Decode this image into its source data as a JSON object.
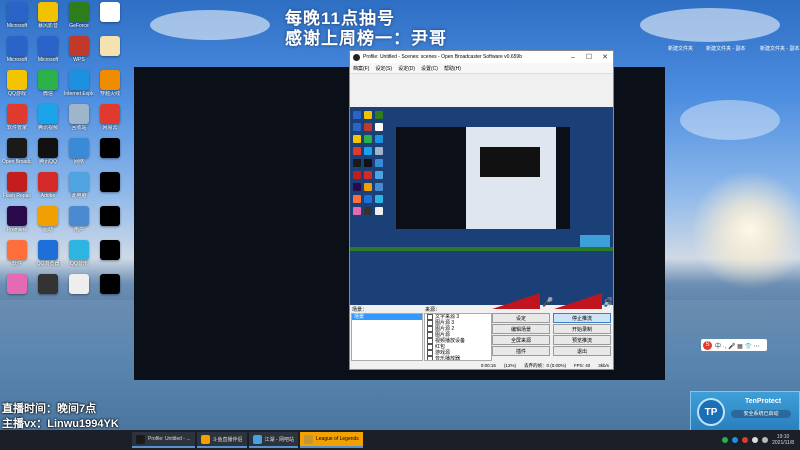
{
  "overlay": {
    "line1": "每晚11点抽号",
    "line2": "感谢上周榜一：尹哥"
  },
  "desktop_icons": [
    {
      "label": "Microsoft",
      "color": "#2a64c8"
    },
    {
      "label": "暴风影音",
      "color": "#f2c200"
    },
    {
      "label": "GeForce",
      "color": "#2e7d1b"
    },
    {
      "label": "",
      "color": "#ffffff"
    },
    {
      "label": "Microsoft",
      "color": "#2a64c8"
    },
    {
      "label": "Microsoft",
      "color": "#2a64c8"
    },
    {
      "label": "WPS",
      "color": "#c0392b"
    },
    {
      "label": "",
      "color": "#f4e2b0"
    },
    {
      "label": "QQ游戏",
      "color": "#f5c400"
    },
    {
      "label": "微信",
      "color": "#2ab14a"
    },
    {
      "label": "Internet Explorer",
      "color": "#1e90e0"
    },
    {
      "label": "穿越火线",
      "color": "#f08c00"
    },
    {
      "label": "软件管家",
      "color": "#e03a2e"
    },
    {
      "label": "腾讯视频",
      "color": "#1aa3e8"
    },
    {
      "label": "回收站",
      "color": "#9fb5c9"
    },
    {
      "label": "网易云",
      "color": "#e03a2e"
    },
    {
      "label": "Open Broadcaster",
      "color": "#1a1a1a"
    },
    {
      "label": "腾讯QQ",
      "color": "#111111"
    },
    {
      "label": "网络",
      "color": "#3a8ad8"
    },
    {
      "label": "",
      "color": "#000000"
    },
    {
      "label": "Flash Repair",
      "color": "#c21e1e"
    },
    {
      "label": "Adobe",
      "color": "#d42a2a"
    },
    {
      "label": "此电脑",
      "color": "#4fa3e0"
    },
    {
      "label": "",
      "color": "#000000"
    },
    {
      "label": "Premiere",
      "color": "#2a0a4a"
    },
    {
      "label": "驱动",
      "color": "#f0a000"
    },
    {
      "label": "用户",
      "color": "#4a8ad0"
    },
    {
      "label": "",
      "color": "#000000"
    },
    {
      "label": "软件",
      "color": "#ff6f3c"
    },
    {
      "label": "QQ浏览器",
      "color": "#1e6fd8"
    },
    {
      "label": "QQ音乐",
      "color": "#2bb5e0"
    },
    {
      "label": "",
      "color": "#000000"
    },
    {
      "label": "",
      "color": "#e46ab4"
    },
    {
      "label": "",
      "color": "#333333"
    },
    {
      "label": "",
      "color": "#eeeeee"
    },
    {
      "label": "",
      "color": "#000000"
    }
  ],
  "right_tags": [
    "新建文件夹",
    "新建文件夹 - 副本",
    "新建文件夹 - 副本"
  ],
  "obs": {
    "title": "Profile: Untitled - Scenes: scenes - Open Broadcaster Software v0.659b",
    "menu": [
      "档案(F)",
      "设定(S)",
      "设定(D)",
      "设置(C)",
      "帮助(H)"
    ],
    "scenes_label": "场景：",
    "scenes": [
      "场景"
    ],
    "sources_label": "来源：",
    "sources": [
      "文字来源 3",
      "图片源 3",
      "图片源 2",
      "图片源",
      "视频播放设备",
      "红包",
      "游戏源",
      "音乐播放器"
    ],
    "buttons": [
      {
        "label": "设定",
        "style": "normal"
      },
      {
        "label": "停止推流",
        "style": "blue"
      },
      {
        "label": "编辑场景",
        "style": "normal"
      },
      {
        "label": "开始录制",
        "style": "normal"
      },
      {
        "label": "全屏来源",
        "style": "normal"
      },
      {
        "label": "预览推流",
        "style": "normal"
      },
      {
        "label": "插件",
        "style": "normal"
      },
      {
        "label": "退出",
        "style": "normal"
      }
    ],
    "status": {
      "time": "0:00:15",
      "dropped": "(12%)",
      "dropped_frames": "丢弃的帧：0 (0.00%)",
      "fps": "FPS: 40",
      "bitrate": "3kb/s"
    },
    "meter_levels": [
      0.82,
      0.9
    ]
  },
  "ime": {
    "text": "中 ·, 🎤 ▦ 👕 ⋯"
  },
  "tenprotect": {
    "name": "TenProtect",
    "sub": "安全系统已启动"
  },
  "stream_overlay": {
    "line1": "直播时间：晚间7点",
    "line2": "主播vx：Linwu1994YK"
  },
  "taskbar": {
    "items": [
      {
        "label": "Profile: Untitled - ...",
        "color": "#1a1a1a",
        "active": false
      },
      {
        "label": "斗鱼直播伴侣",
        "color": "#f2a100",
        "active": false
      },
      {
        "label": "江湖 - 网吧站",
        "color": "#4aa0e0",
        "active": false
      },
      {
        "label": "League of Legends",
        "color": "#c6962e",
        "active": true
      }
    ],
    "time": "19:10",
    "date": "2021/11/8"
  }
}
